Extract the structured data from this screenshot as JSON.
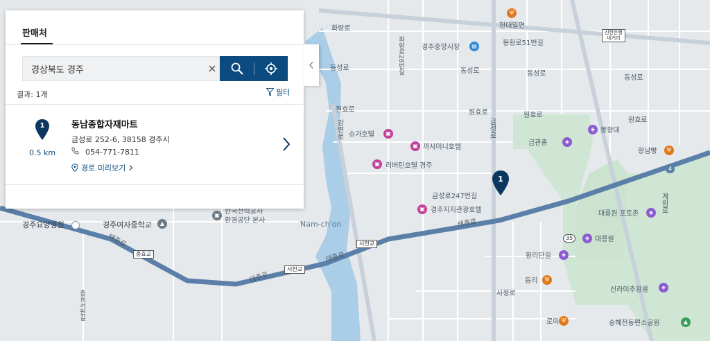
{
  "panel": {
    "tab_label": "판매처",
    "search": {
      "value": "경상북도 경주"
    },
    "result_count": "결과: 1개",
    "filter_label": "필터",
    "results": [
      {
        "marker_number": "1",
        "distance": "0.5 km",
        "name": "동남종합자재마트",
        "address": "금성로 252-6, 38158 경주시",
        "phone": "054-771-7811",
        "route_label": "경로 미리보기"
      }
    ]
  },
  "map": {
    "marker_number": "1",
    "labels": {
      "hwarangro": "화랑로",
      "hyundai": "현대밀면",
      "gyeongju_market": "경주중앙시장",
      "bongwhangro51": "봉황로51번길",
      "singeongjonggeori": "신한은행네거리",
      "dongseongro_a": "동성로",
      "dongseongro_b": "동성로",
      "dongseongro_c": "동성로",
      "dongseongro_d": "동성로",
      "wonhyoro_a": "원효로",
      "wonhyoro_b": "원효로",
      "wonhyoro_c": "원효로",
      "wonhyoro_d": "원효로",
      "suga_hotel": "슈가호텔",
      "kkasami_hotel": "까사미니호텔",
      "riverton_hotel": "리버틴호텔 경주",
      "geumseongro247": "금성로247번길",
      "gyeongju_jisi_hotel": "경주지지관광호텔",
      "bonghwangdae": "봉황대",
      "geumgwanchong": "금관총",
      "hwangnambang": "황남빵",
      "daereungwon_potojon": "대릉원 포토존",
      "daereungwon": "대릉원",
      "hwangridangil": "황리단길",
      "dongri": "동리",
      "sillamichu": "신라미추왕릉",
      "sunghyedong": "숭혜전동편소공원",
      "rotemi": "로미",
      "gyeongju_yoyang": "경주요양병원",
      "gyeongju_girls": "경주여자중학교",
      "power_company": "한국전력공사",
      "env_hq": "환경공단 본사",
      "namcheon": "Nam-ch'on",
      "taejongro_a": "태종로",
      "taejongro_b": "태종로",
      "taejongro_c": "태종로",
      "taejongro_d": "태종로",
      "geumseongro": "금성로",
      "gangbyeonro": "강변로",
      "sajeongro": "사정로",
      "gyerimro": "계림로",
      "chunghyoro": "충효서원길",
      "hwarangro_v": "화랑로28번길",
      "junghyo_gyo": "충효교",
      "seocheon_gyo": "서천교",
      "seocheon_gyo2": "서천교",
      "route_35": "35",
      "route_4": "4"
    }
  }
}
